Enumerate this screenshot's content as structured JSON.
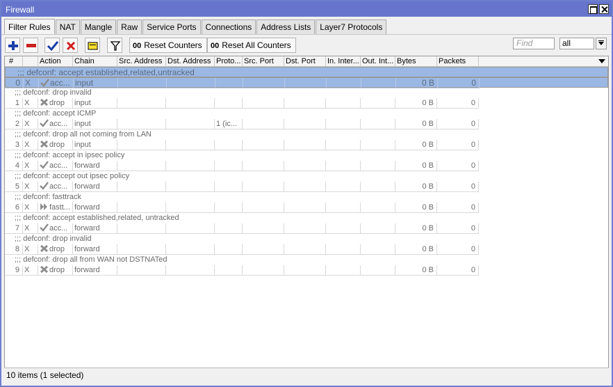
{
  "window": {
    "title": "Firewall"
  },
  "tabs": [
    "Filter Rules",
    "NAT",
    "Mangle",
    "Raw",
    "Service Ports",
    "Connections",
    "Address Lists",
    "Layer7 Protocols"
  ],
  "toolbar": {
    "reset_counters": "Reset Counters",
    "reset_all_counters": "Reset All Counters",
    "counter_icon": "00",
    "find_placeholder": "Find",
    "filter_value": "all"
  },
  "columns": [
    "#",
    "",
    "Action",
    "Chain",
    "Src. Address",
    "Dst. Address",
    "Proto...",
    "Src. Port",
    "Dst. Port",
    "In. Inter...",
    "Out. Int...",
    "Bytes",
    "Packets"
  ],
  "rules": [
    {
      "comment": ";;; defconf: accept established,related,untracked",
      "num": "0",
      "flag": "X",
      "action": "acc...",
      "action_icon": "check-icon",
      "chain": "input",
      "proto": "",
      "bytes": "0 B",
      "packets": "0",
      "selected": true
    },
    {
      "comment": ";;; defconf: drop invalid",
      "num": "1",
      "flag": "X",
      "action": "drop",
      "action_icon": "drop-icon",
      "chain": "input",
      "proto": "",
      "bytes": "0 B",
      "packets": "0",
      "selected": false
    },
    {
      "comment": ";;; defconf: accept ICMP",
      "num": "2",
      "flag": "X",
      "action": "acc...",
      "action_icon": "check-icon",
      "chain": "input",
      "proto": "1 (ic...",
      "bytes": "0 B",
      "packets": "0",
      "selected": false
    },
    {
      "comment": ";;; defconf: drop all not coming from LAN",
      "num": "3",
      "flag": "X",
      "action": "drop",
      "action_icon": "drop-icon",
      "chain": "input",
      "proto": "",
      "bytes": "0 B",
      "packets": "0",
      "selected": false
    },
    {
      "comment": ";;; defconf: accept in ipsec policy",
      "num": "4",
      "flag": "X",
      "action": "acc...",
      "action_icon": "check-icon",
      "chain": "forward",
      "proto": "",
      "bytes": "0 B",
      "packets": "0",
      "selected": false
    },
    {
      "comment": ";;; defconf: accept out ipsec policy",
      "num": "5",
      "flag": "X",
      "action": "acc...",
      "action_icon": "check-icon",
      "chain": "forward",
      "proto": "",
      "bytes": "0 B",
      "packets": "0",
      "selected": false
    },
    {
      "comment": ";;; defconf: fasttrack",
      "num": "6",
      "flag": "X",
      "action": "fastt...",
      "action_icon": "fasttrack-icon",
      "chain": "forward",
      "proto": "",
      "bytes": "0 B",
      "packets": "0",
      "selected": false
    },
    {
      "comment": ";;; defconf: accept established,related, untracked",
      "num": "7",
      "flag": "X",
      "action": "acc...",
      "action_icon": "check-icon",
      "chain": "forward",
      "proto": "",
      "bytes": "0 B",
      "packets": "0",
      "selected": false
    },
    {
      "comment": ";;; defconf: drop invalid",
      "num": "8",
      "flag": "X",
      "action": "drop",
      "action_icon": "drop-icon",
      "chain": "forward",
      "proto": "",
      "bytes": "0 B",
      "packets": "0",
      "selected": false
    },
    {
      "comment": ";;; defconf:  drop all from WAN not DSTNATed",
      "num": "9",
      "flag": "X",
      "action": "drop",
      "action_icon": "drop-icon",
      "chain": "forward",
      "proto": "",
      "bytes": "0 B",
      "packets": "0",
      "selected": false
    }
  ],
  "status": "10 items (1 selected)",
  "colors": {
    "titlebar": "#6675cb",
    "selection": "#9bb8e4"
  }
}
